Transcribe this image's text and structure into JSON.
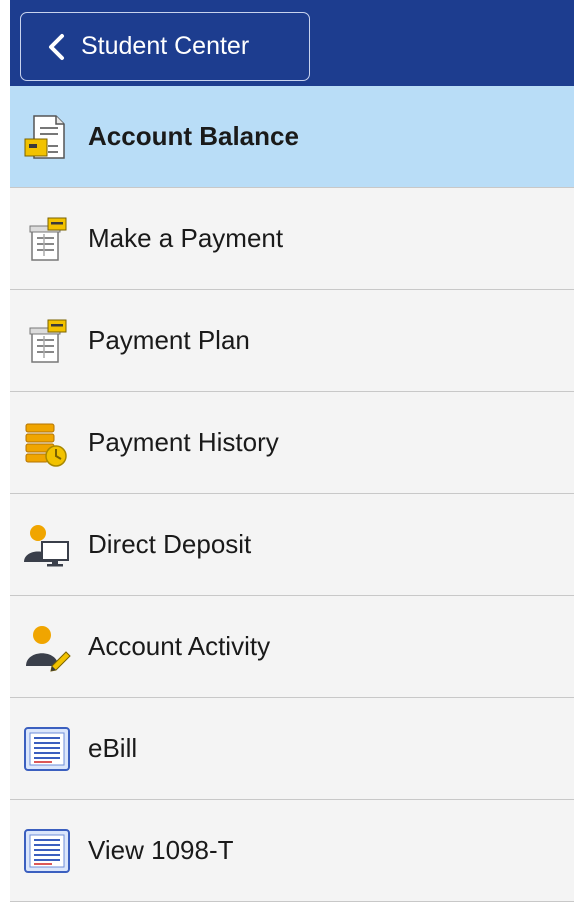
{
  "header": {
    "back_label": "Student Center",
    "background_color": "#1d3d8f"
  },
  "nav": {
    "selected_color": "#b9ddf7",
    "items": [
      {
        "label": "Account Balance",
        "icon": "account-balance-icon",
        "selected": true
      },
      {
        "label": "Make a Payment",
        "icon": "make-payment-icon",
        "selected": false
      },
      {
        "label": "Payment Plan",
        "icon": "payment-plan-icon",
        "selected": false
      },
      {
        "label": "Payment History",
        "icon": "payment-history-icon",
        "selected": false
      },
      {
        "label": "Direct Deposit",
        "icon": "direct-deposit-icon",
        "selected": false
      },
      {
        "label": "Account Activity",
        "icon": "account-activity-icon",
        "selected": false
      },
      {
        "label": "eBill",
        "icon": "ebill-icon",
        "selected": false
      },
      {
        "label": "View 1098-T",
        "icon": "view-1098t-icon",
        "selected": false
      }
    ]
  }
}
